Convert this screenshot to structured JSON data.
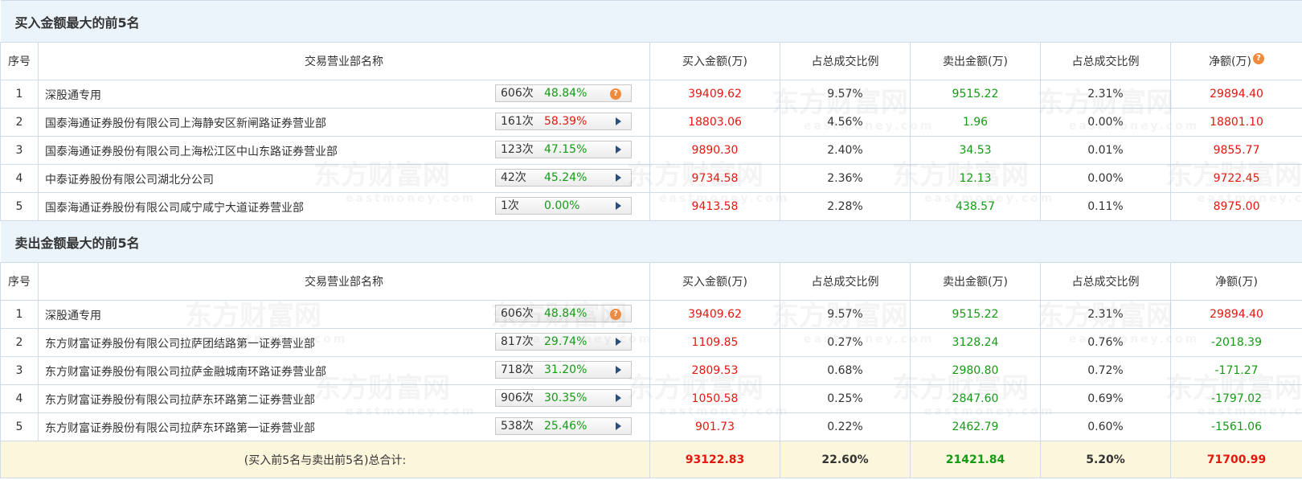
{
  "sections": [
    {
      "title": "买入金额最大的前5名",
      "headers": [
        "序号",
        "交易营业部名称",
        "买入金额(万)",
        "占总成交比例",
        "卖出金额(万)",
        "占总成交比例",
        "净额(万)"
      ],
      "rows": [
        {
          "seq": "1",
          "name": "深股通专用",
          "count": "606次",
          "pct": "48.84%",
          "pct_color": "green",
          "icon": "help",
          "buy": "39409.62",
          "buy_ratio": "9.57%",
          "sell": "9515.22",
          "sell_ratio": "2.31%",
          "net": "29894.40",
          "net_color": "red"
        },
        {
          "seq": "2",
          "name": "国泰海通证券股份有限公司上海静安区新闸路证券营业部",
          "count": "161次",
          "pct": "58.39%",
          "pct_color": "red",
          "icon": "arrow",
          "buy": "18803.06",
          "buy_ratio": "4.56%",
          "sell": "1.96",
          "sell_ratio": "0.00%",
          "net": "18801.10",
          "net_color": "red"
        },
        {
          "seq": "3",
          "name": "国泰海通证券股份有限公司上海松江区中山东路证券营业部",
          "count": "123次",
          "pct": "47.15%",
          "pct_color": "green",
          "icon": "arrow",
          "buy": "9890.30",
          "buy_ratio": "2.40%",
          "sell": "34.53",
          "sell_ratio": "0.01%",
          "net": "9855.77",
          "net_color": "red"
        },
        {
          "seq": "4",
          "name": "中泰证券股份有限公司湖北分公司",
          "count": "42次",
          "pct": "45.24%",
          "pct_color": "green",
          "icon": "arrow",
          "buy": "9734.58",
          "buy_ratio": "2.36%",
          "sell": "12.13",
          "sell_ratio": "0.00%",
          "net": "9722.45",
          "net_color": "red"
        },
        {
          "seq": "5",
          "name": "国泰海通证券股份有限公司咸宁咸宁大道证券营业部",
          "count": "1次",
          "pct": "0.00%",
          "pct_color": "green",
          "icon": "arrow",
          "buy": "9413.58",
          "buy_ratio": "2.28%",
          "sell": "438.57",
          "sell_ratio": "0.11%",
          "net": "8975.00",
          "net_color": "red"
        }
      ]
    },
    {
      "title": "卖出金额最大的前5名",
      "headers": [
        "序号",
        "交易营业部名称",
        "买入金额(万)",
        "占总成交比例",
        "卖出金额(万)",
        "占总成交比例",
        "净额(万)"
      ],
      "rows": [
        {
          "seq": "1",
          "name": "深股通专用",
          "count": "606次",
          "pct": "48.84%",
          "pct_color": "green",
          "icon": "help",
          "buy": "39409.62",
          "buy_ratio": "9.57%",
          "sell": "9515.22",
          "sell_ratio": "2.31%",
          "net": "29894.40",
          "net_color": "red"
        },
        {
          "seq": "2",
          "name": "东方财富证券股份有限公司拉萨团结路第一证券营业部",
          "count": "817次",
          "pct": "29.74%",
          "pct_color": "green",
          "icon": "arrow",
          "buy": "1109.85",
          "buy_ratio": "0.27%",
          "sell": "3128.24",
          "sell_ratio": "0.76%",
          "net": "-2018.39",
          "net_color": "green"
        },
        {
          "seq": "3",
          "name": "东方财富证券股份有限公司拉萨金融城南环路证券营业部",
          "count": "718次",
          "pct": "31.20%",
          "pct_color": "green",
          "icon": "arrow",
          "buy": "2809.53",
          "buy_ratio": "0.68%",
          "sell": "2980.80",
          "sell_ratio": "0.72%",
          "net": "-171.27",
          "net_color": "green"
        },
        {
          "seq": "4",
          "name": "东方财富证券股份有限公司拉萨东环路第二证券营业部",
          "count": "906次",
          "pct": "30.35%",
          "pct_color": "green",
          "icon": "arrow",
          "buy": "1050.58",
          "buy_ratio": "0.25%",
          "sell": "2847.60",
          "sell_ratio": "0.69%",
          "net": "-1797.02",
          "net_color": "green"
        },
        {
          "seq": "5",
          "name": "东方财富证券股份有限公司拉萨东环路第一证券营业部",
          "count": "538次",
          "pct": "25.46%",
          "pct_color": "green",
          "icon": "arrow",
          "buy": "901.73",
          "buy_ratio": "0.22%",
          "sell": "2462.79",
          "sell_ratio": "0.60%",
          "net": "-1561.06",
          "net_color": "green"
        }
      ]
    }
  ],
  "total": {
    "label": "(买入前5名与卖出前5名)总合计:",
    "buy": "93122.83",
    "buy_ratio": "22.60%",
    "sell": "21421.84",
    "sell_ratio": "5.20%",
    "net": "71700.99"
  },
  "help_icon_glyph": "?",
  "watermark": {
    "text": "东方财富网",
    "sub": "eastmoney.com"
  },
  "colors": {
    "red": "#e4170f",
    "green": "#149b14",
    "section_bg": "#ecf4fb",
    "total_bg": "#fbf6dc",
    "border": "#cfdbe8",
    "help_icon": "#f08a3c"
  }
}
